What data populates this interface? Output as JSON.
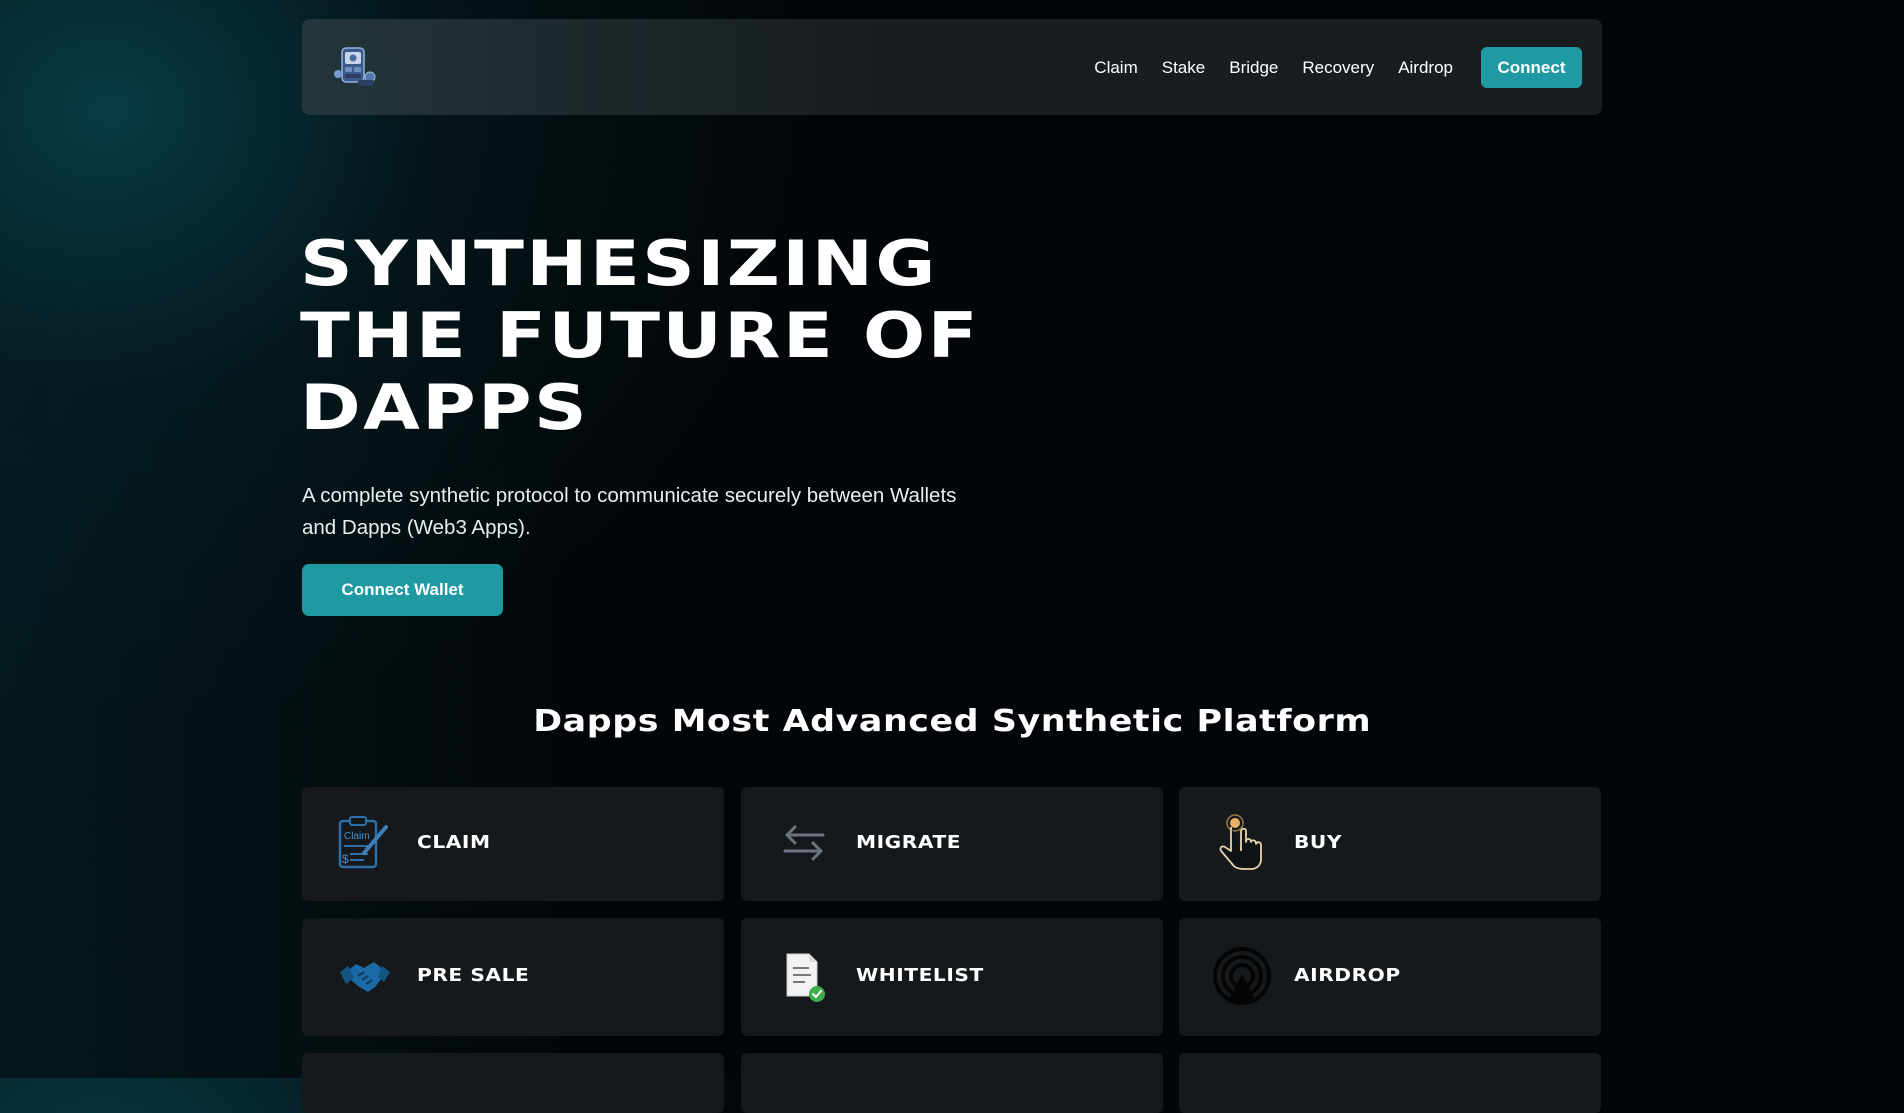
{
  "nav": {
    "links": [
      "Claim",
      "Stake",
      "Bridge",
      "Recovery",
      "Airdrop"
    ],
    "connect_label": "Connect"
  },
  "hero": {
    "title_lines": [
      "SYNTHESIZING",
      "THE FUTURE OF",
      "DAPPS"
    ],
    "subtitle_line1": "A complete synthetic protocol to communicate securely between Wallets",
    "subtitle_line2": "and Dapps (Web3 Apps).",
    "button_label": "Connect Wallet"
  },
  "section": {
    "title": "Dapps Most Advanced Synthetic Platform",
    "cards": [
      {
        "label": "CLAIM",
        "icon": "claim-clipboard-icon"
      },
      {
        "label": "MIGRATE",
        "icon": "migrate-arrows-icon"
      },
      {
        "label": "BUY",
        "icon": "tap-hand-icon"
      },
      {
        "label": "PRE SALE",
        "icon": "handshake-icon"
      },
      {
        "label": "WHITELIST",
        "icon": "whitelist-document-icon"
      },
      {
        "label": "AIRDROP",
        "icon": "airdrop-signal-icon"
      }
    ]
  },
  "colors": {
    "accent": "#1f9aa3",
    "card_bg": "#15191c",
    "page_bg": "#030608"
  }
}
